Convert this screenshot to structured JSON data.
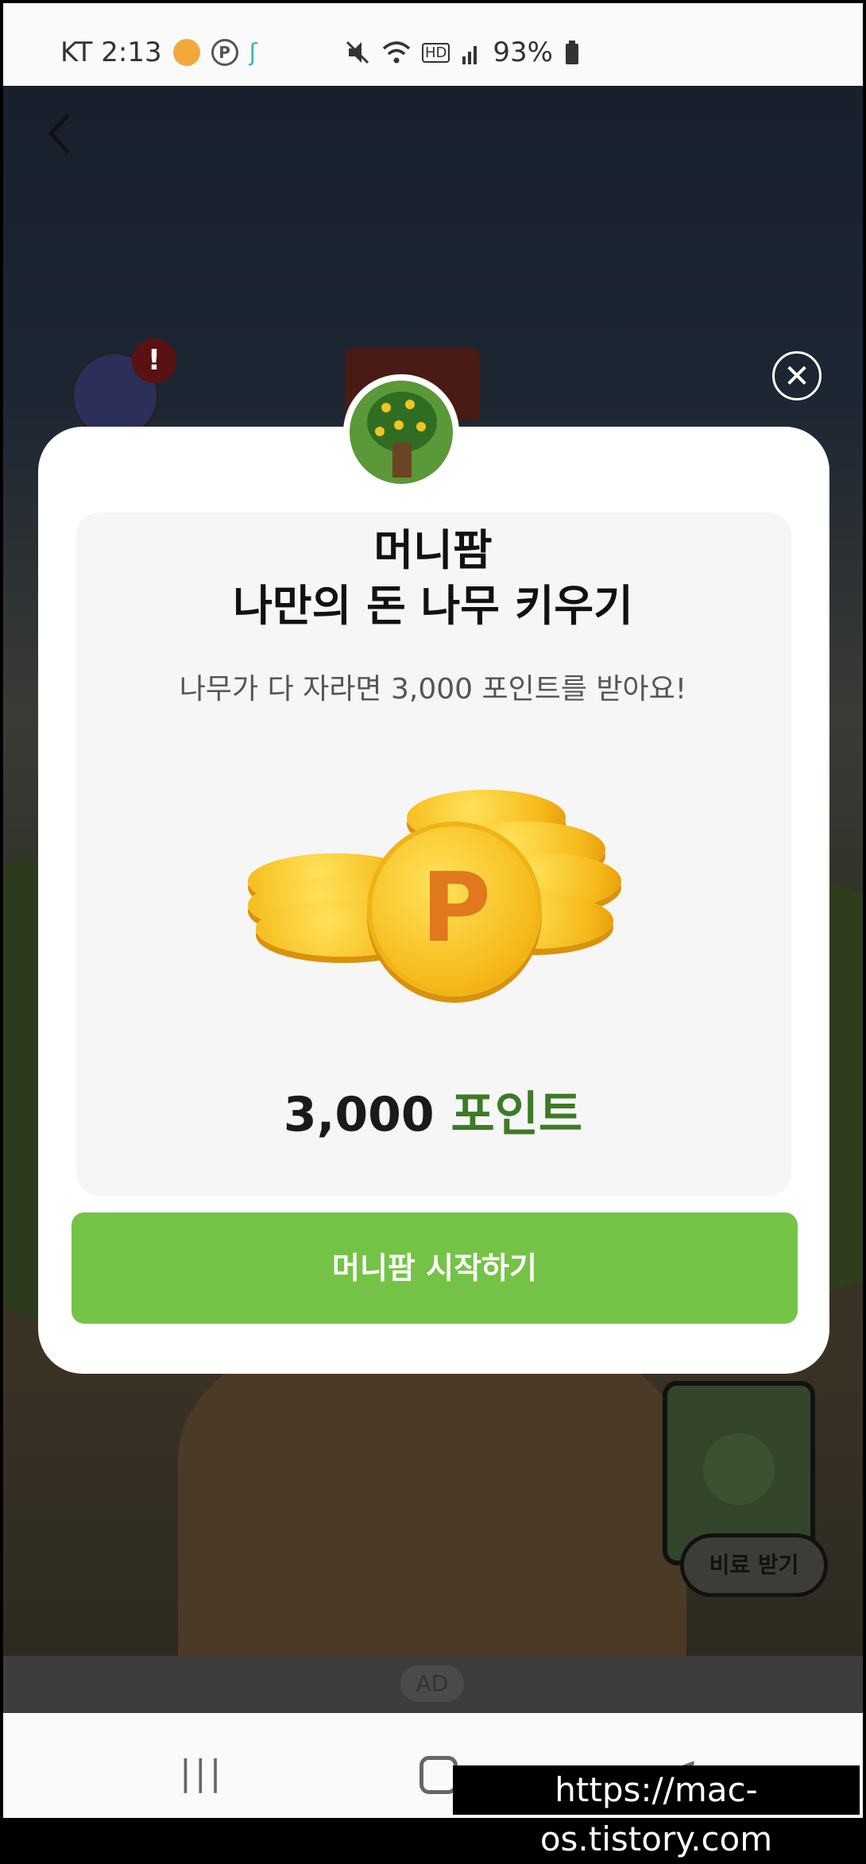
{
  "status_bar": {
    "carrier_time": "KT 2:13",
    "battery": "93%",
    "hd": "HD",
    "icons": [
      "mute-icon",
      "wifi-icon",
      "signal-icon",
      "battery-icon"
    ]
  },
  "game": {
    "fertilizer_button": "비료 받기",
    "ad_label": "AD"
  },
  "modal": {
    "title_line1": "머니팜",
    "title_line2": "나만의 돈 나무 키우기",
    "subtitle": "나무가 다 자라면 3,000 포인트를 받아요!",
    "points_number": "3,000",
    "points_unit": "포인트",
    "coin_letter": "P",
    "start_button": "머니팜 시작하기",
    "close_symbol": "✕"
  },
  "nav": {
    "recent": "|||",
    "back": "<"
  },
  "watermark": "https://mac-os.tistory.com",
  "colors": {
    "accent_green": "#74c346",
    "points_green": "#3d7a24",
    "coin_gold": "#f6b919"
  }
}
